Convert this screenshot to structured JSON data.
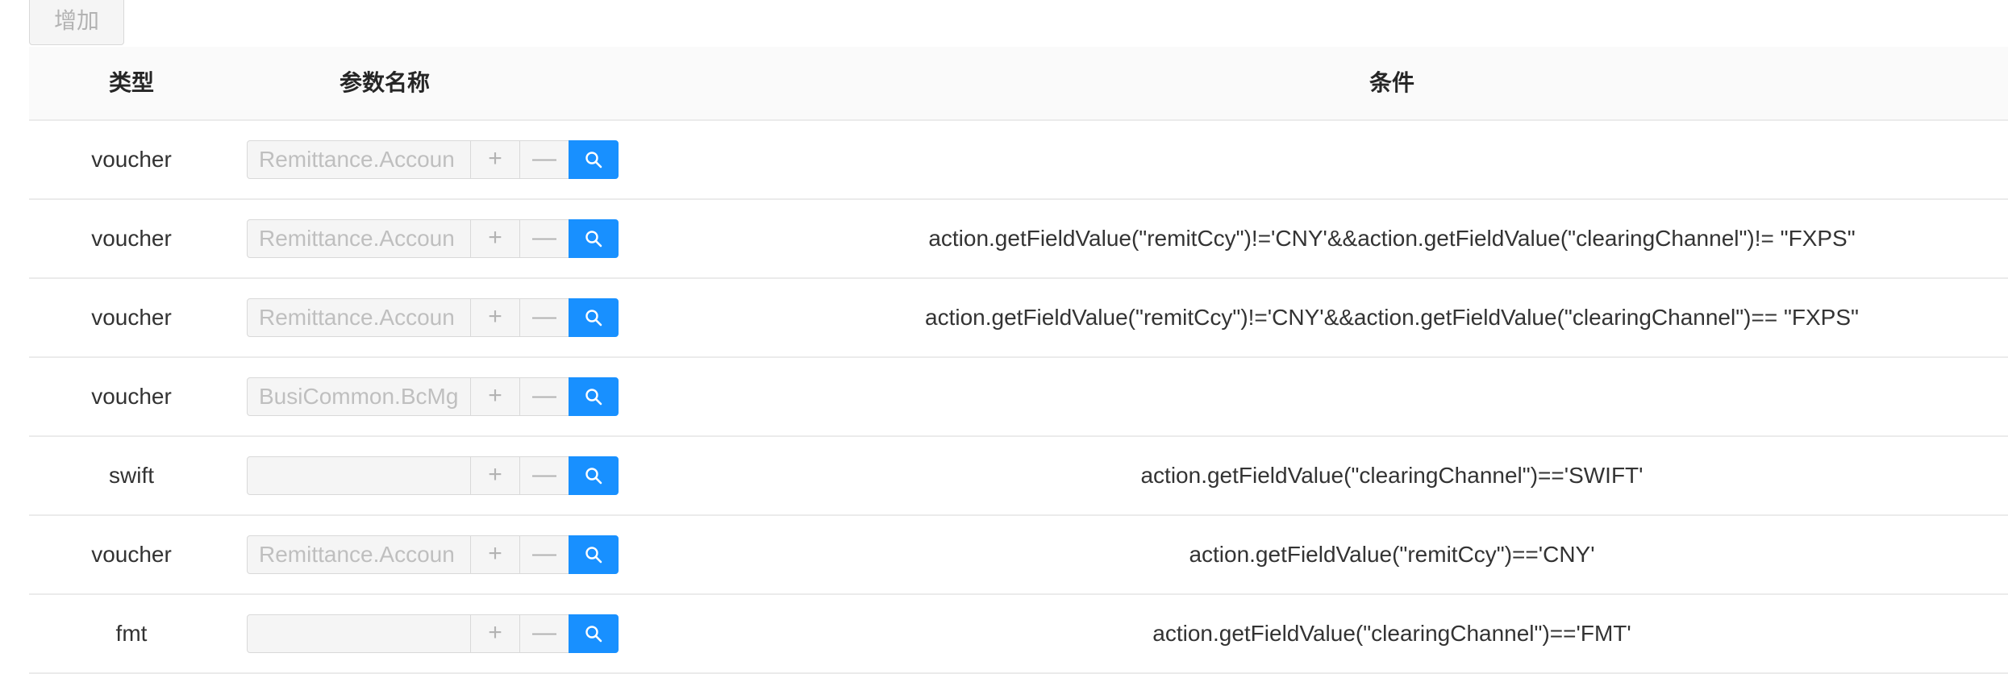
{
  "toolbar": {
    "add_label": "增加"
  },
  "table": {
    "headers": {
      "type": "类型",
      "param": "参数名称",
      "condition": "条件"
    },
    "plus_label": "+",
    "minus_label": "—",
    "rows": [
      {
        "type": "voucher",
        "param": "Remittance.Accoun",
        "condition": ""
      },
      {
        "type": "voucher",
        "param": "Remittance.Accoun",
        "condition": "action.getFieldValue(\"remitCcy\")!='CNY'&&action.getFieldValue(\"clearingChannel\")!= \"FXPS\""
      },
      {
        "type": "voucher",
        "param": "Remittance.Accoun",
        "condition": "action.getFieldValue(\"remitCcy\")!='CNY'&&action.getFieldValue(\"clearingChannel\")== \"FXPS\""
      },
      {
        "type": "voucher",
        "param": "BusiCommon.BcMg",
        "condition": ""
      },
      {
        "type": "swift",
        "param": "",
        "condition": "action.getFieldValue(\"clearingChannel\")=='SWIFT'"
      },
      {
        "type": "voucher",
        "param": "Remittance.Accoun",
        "condition": "action.getFieldValue(\"remitCcy\")=='CNY'"
      },
      {
        "type": "fmt",
        "param": "",
        "condition": "action.getFieldValue(\"clearingChannel\")=='FMT'"
      }
    ]
  },
  "colors": {
    "primary": "#1890ff",
    "header_bg": "#fafafa",
    "border": "#ebebeb"
  },
  "icons": {
    "search": "search-icon"
  }
}
